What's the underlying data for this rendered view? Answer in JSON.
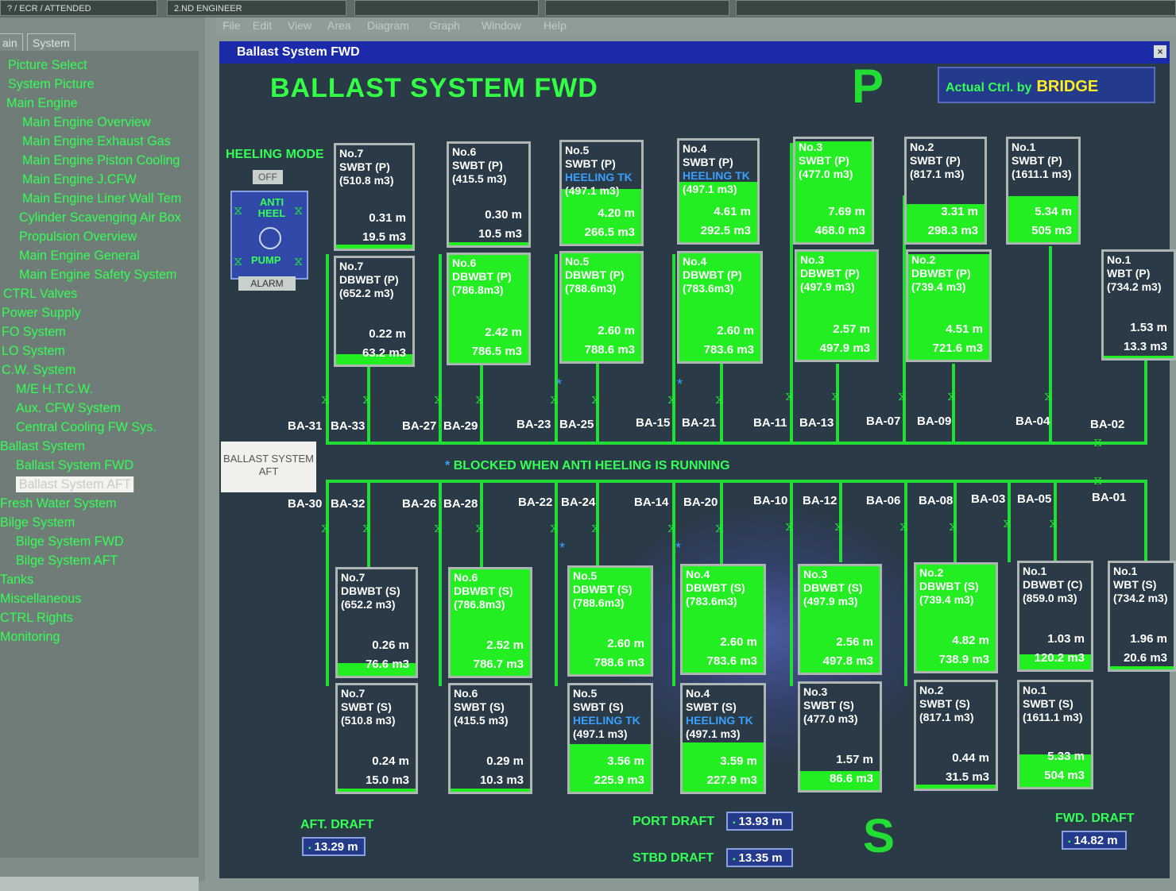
{
  "topbar": {
    "box1": "? / ECR / ATTENDED",
    "box2": "2.ND ENGINEER"
  },
  "sidebar": {
    "tabs": [
      "ain",
      "System"
    ],
    "items": [
      "Picture Select",
      "System Picture",
      "Main Engine",
      "Main Engine Overview",
      "Main Engine Exhaust Gas",
      "Main Engine Piston Cooling",
      "Main Engine J.CFW",
      "Main Engine Liner Wall Tem",
      "Cylinder Scavenging Air Box",
      "Propulsion Overview",
      "Main Engine General",
      "Main Engine Safety System",
      "CTRL Valves",
      "Power Supply",
      "FO System",
      "LO System",
      "C.W. System",
      "M/E H.T.C.W.",
      "Aux. CFW System",
      "Central Cooling FW Sys.",
      "Ballast System",
      "Ballast System FWD",
      "Ballast System AFT",
      "Fresh Water System",
      "Bilge System",
      "Bilge System FWD",
      "Bilge System AFT",
      "Tanks",
      "Miscellaneous",
      "CTRL Rights",
      "Monitoring"
    ]
  },
  "menu": [
    "File",
    "Edit",
    "View",
    "Area",
    "Diagram",
    "Graph",
    "Window",
    "Help"
  ],
  "window": {
    "title": "Ballast System FWD",
    "close": "×"
  },
  "screen": {
    "title": "BALLAST SYSTEM FWD",
    "port_letter": "P",
    "stbd_letter": "S",
    "ctrl_label": "Actual Ctrl. by",
    "ctrl_value": "BRIDGE",
    "heeling_mode": "HEELING MODE",
    "off": "OFF",
    "anti_heel": "ANTI HEEL",
    "pump": "PUMP",
    "alarm": "ALARM",
    "blocked_note": "BLOCKED WHEN ANTI HEELING IS RUNNING",
    "blocked_star": "*",
    "aft_button": "BALLAST SYSTEM AFT",
    "aft_draft_label": "AFT. DRAFT",
    "aft_draft": "13.29 m",
    "port_draft_label": "PORT DRAFT",
    "port_draft": "13.93 m",
    "stbd_draft_label": "STBD DRAFT",
    "stbd_draft": "13.35 m",
    "fwd_draft_label": "FWD. DRAFT",
    "fwd_draft": "14.82 m",
    "draft_marker": "▪"
  },
  "tanks": {
    "p_swbt_7": {
      "name": "No.7\nSWBT (P)\n(510.8 m3)",
      "level": "0.31 m",
      "volume": "19.5 m3",
      "fill": 0.04
    },
    "p_swbt_6": {
      "name": "No.6\nSWBT (P)\n(415.5 m3)",
      "level": "0.30 m",
      "volume": "10.5 m3",
      "fill": 0.03
    },
    "p_swbt_5": {
      "name": "No.5\nSWBT (P)",
      "heel": "HEELING TK",
      "cap": "(497.1 m3)",
      "level": "4.20 m",
      "volume": "266.5 m3",
      "fill": 0.54
    },
    "p_swbt_4": {
      "name": "No.4\nSWBT (P)",
      "heel": "HEELING TK",
      "cap": "(497.1 m3)",
      "level": "4.61 m",
      "volume": "292.5 m3",
      "fill": 0.59
    },
    "p_swbt_3": {
      "name": "No.3\nSWBT (P)\n(477.0 m3)",
      "level": "7.69 m",
      "volume": "468.0 m3",
      "fill": 0.98
    },
    "p_swbt_2": {
      "name": "No.2\nSWBT (P)\n(817.1 m3)",
      "level": "3.31 m",
      "volume": "298.3 m3",
      "fill": 0.37
    },
    "p_swbt_1": {
      "name": "No.1\nSWBT (P)\n(1611.1 m3)",
      "level": "5.34 m",
      "volume": "505 m3",
      "fill": 0.45
    },
    "p_dbwbt_7": {
      "name": "No.7\nDBWBT (P)\n(652.2 m3)",
      "level": "0.22 m",
      "volume": "63.2 m3",
      "fill": 0.1
    },
    "p_dbwbt_6": {
      "name": "No.6\nDBWBT (P)\n(786.8m3)",
      "level": "2.42 m",
      "volume": "786.5 m3",
      "fill": 1.0
    },
    "p_dbwbt_5": {
      "name": "No.5\nDBWBT (P)\n(788.6m3)",
      "level": "2.60 m",
      "volume": "788.6 m3",
      "fill": 1.0
    },
    "p_dbwbt_4": {
      "name": "No.4\nDBWBT (P)\n(783.6m3)",
      "level": "2.60 m",
      "volume": "783.6 m3",
      "fill": 1.0
    },
    "p_dbwbt_3": {
      "name": "No.3\nDBWBT (P)\n(497.9 m3)",
      "level": "2.57 m",
      "volume": "497.9 m3",
      "fill": 1.0
    },
    "p_dbwbt_2": {
      "name": "No.2\nDBWBT (P)\n(739.4 m3)",
      "level": "4.51 m",
      "volume": "721.6 m3",
      "fill": 0.98
    },
    "p_wbt_1": {
      "name": "No.1\nWBT (P)\n(734.2 m3)",
      "level": "1.53 m",
      "volume": "13.3 m3",
      "fill": 0.02
    },
    "s_dbwbt_7": {
      "name": "No.7\nDBWBT (S)\n(652.2 m3)",
      "level": "0.26 m",
      "volume": "76.6 m3",
      "fill": 0.12
    },
    "s_dbwbt_6": {
      "name": "No.6\nDBWBT (S)\n(786.8m3)",
      "level": "2.52 m",
      "volume": "786.7 m3",
      "fill": 1.0
    },
    "s_dbwbt_5": {
      "name": "No.5\nDBWBT (S)\n(788.6m3)",
      "level": "2.60 m",
      "volume": "788.6 m3",
      "fill": 1.0
    },
    "s_dbwbt_4": {
      "name": "No.4\nDBWBT (S)\n(783.6m3)",
      "level": "2.60 m",
      "volume": "783.6 m3",
      "fill": 1.0
    },
    "s_dbwbt_3": {
      "name": "No.3\nDBWBT (S)\n(497.9 m3)",
      "level": "2.56 m",
      "volume": "497.8 m3",
      "fill": 1.0
    },
    "s_dbwbt_2": {
      "name": "No.2\nDBWBT (S)\n(739.4 m3)",
      "level": "4.82 m",
      "volume": "738.9 m3",
      "fill": 1.0
    },
    "s_dbwbt_c1": {
      "name": "No.1\nDBWBT (C)\n(859.0 m3)",
      "level": "1.03 m",
      "volume": "120.2 m3",
      "fill": 0.14
    },
    "s_wbt_1": {
      "name": "No.1\nWBT (S)\n(734.2 m3)",
      "level": "1.96 m",
      "volume": "20.6 m3",
      "fill": 0.03
    },
    "s_swbt_7": {
      "name": "No.7\nSWBT (S)\n(510.8 m3)",
      "level": "0.24 m",
      "volume": "15.0 m3",
      "fill": 0.03
    },
    "s_swbt_6": {
      "name": "No.6\nSWBT (S)\n(415.5 m3)",
      "level": "0.29 m",
      "volume": "10.3 m3",
      "fill": 0.03
    },
    "s_swbt_5": {
      "name": "No.5\nSWBT (S)",
      "heel": "HEELING TK",
      "cap": "(497.1 m3)",
      "level": "3.56 m",
      "volume": "225.9 m3",
      "fill": 0.45
    },
    "s_swbt_4": {
      "name": "No.4\nSWBT (S)",
      "heel": "HEELING TK",
      "cap": "(497.1 m3)",
      "level": "3.59 m",
      "volume": "227.9 m3",
      "fill": 0.46
    },
    "s_swbt_3": {
      "name": "No.3\nSWBT (S)\n(477.0 m3)",
      "level": "1.57 m",
      "volume": "86.6 m3",
      "fill": 0.18
    },
    "s_swbt_2": {
      "name": "No.2\nSWBT (S)\n(817.1 m3)",
      "level": "0.44 m",
      "volume": "31.5 m3",
      "fill": 0.04
    },
    "s_swbt_1": {
      "name": "No.1\nSWBT (S)\n(1611.1 m3)",
      "level": "5.33 m",
      "volume": "504 m3",
      "fill": 0.31
    }
  },
  "valves": [
    "BA-31",
    "BA-33",
    "BA-27",
    "BA-29",
    "BA-23",
    "BA-25",
    "BA-15",
    "BA-21",
    "BA-11",
    "BA-13",
    "BA-07",
    "BA-09",
    "BA-04",
    "BA-02",
    "BA-30",
    "BA-32",
    "BA-26",
    "BA-28",
    "BA-22",
    "BA-24",
    "BA-14",
    "BA-20",
    "BA-10",
    "BA-12",
    "BA-06",
    "BA-08",
    "BA-03",
    "BA-05",
    "BA-01"
  ],
  "valve_symbol": "⧖"
}
